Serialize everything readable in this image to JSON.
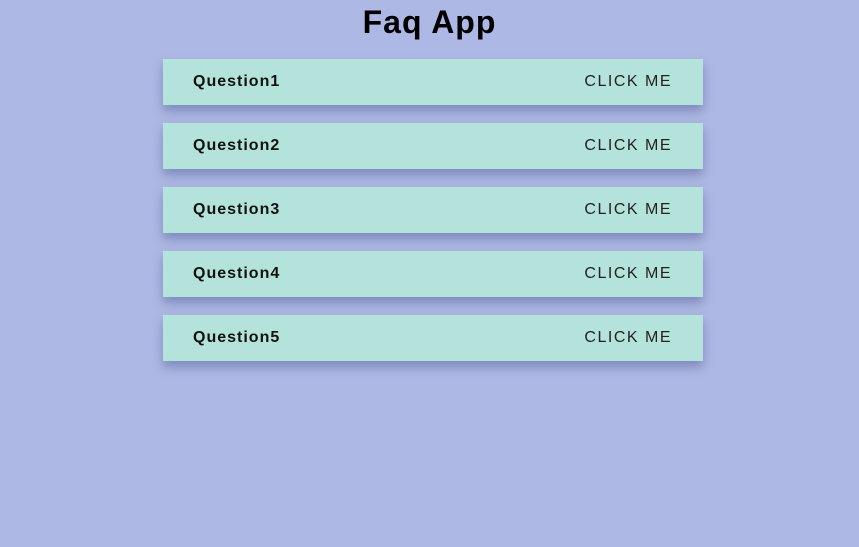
{
  "app": {
    "title": "Faq App"
  },
  "faq": {
    "items": [
      {
        "question": "Question1",
        "button_label": "CLICK ME"
      },
      {
        "question": "Question2",
        "button_label": "CLICK ME"
      },
      {
        "question": "Question3",
        "button_label": "CLICK ME"
      },
      {
        "question": "Question4",
        "button_label": "CLICK ME"
      },
      {
        "question": "Question5",
        "button_label": "CLICK ME"
      }
    ]
  },
  "colors": {
    "background": "#aeb8e4",
    "card": "#b4e3dc",
    "text": "#000000"
  }
}
